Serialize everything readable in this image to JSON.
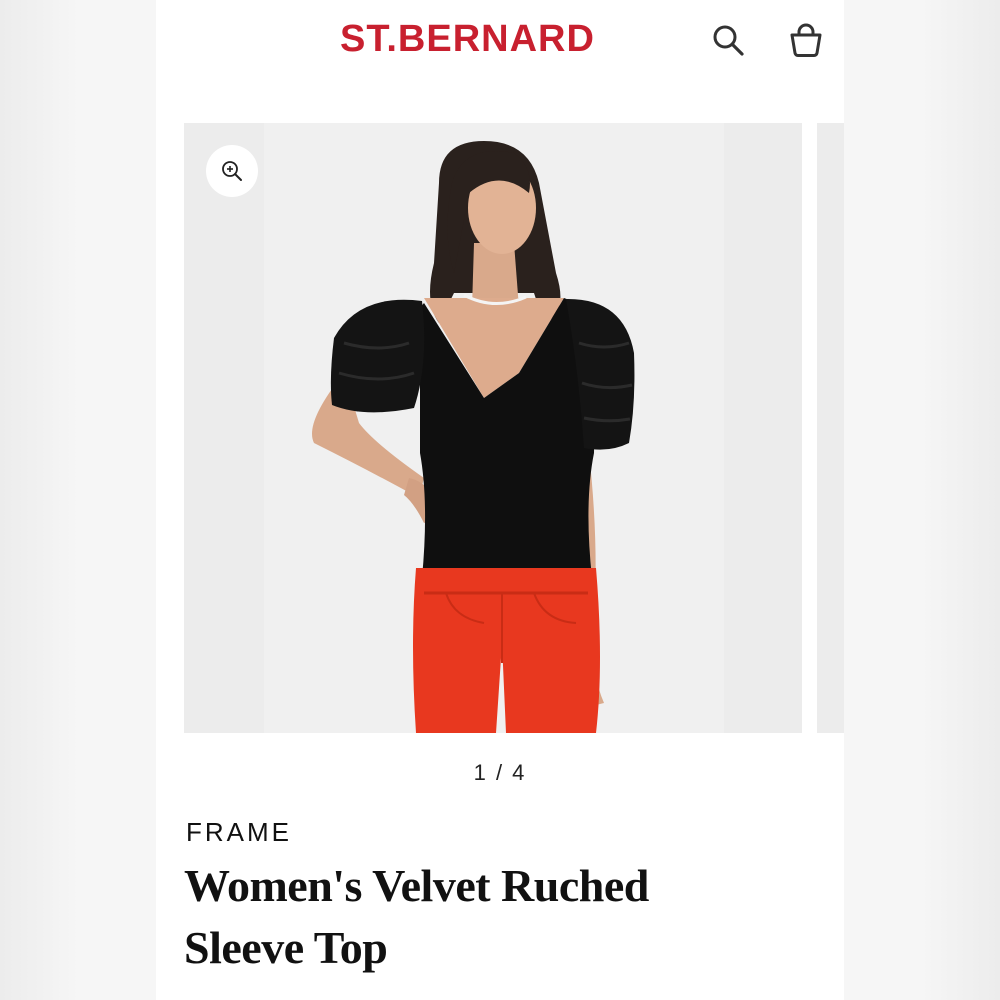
{
  "header": {
    "logo_text": "ST.BERNARD",
    "brand_color": "#c8202f",
    "search_icon": "search-icon",
    "bag_icon": "shopping-bag-icon"
  },
  "gallery": {
    "zoom_icon": "zoom-in-icon",
    "current": 1,
    "total": 4,
    "pager_text": "1 / 4",
    "image_subject": "model wearing black velvet top with puff sleeves and red jeans"
  },
  "product": {
    "brand": "FRAME",
    "title": "Women's Velvet Ruched Sleeve Top"
  }
}
